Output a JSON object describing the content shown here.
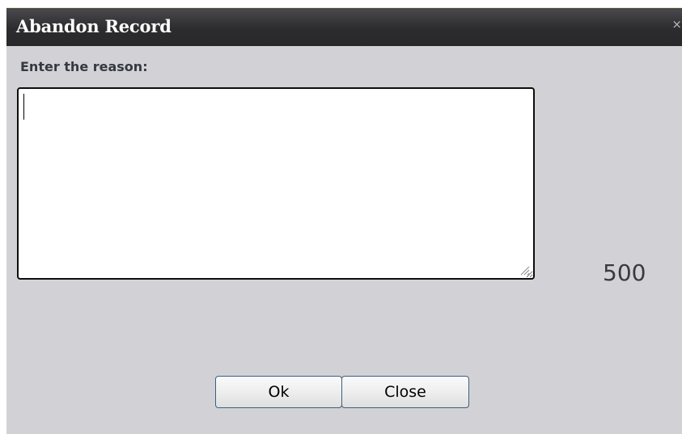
{
  "dialog": {
    "title": "Abandon Record",
    "close_glyph": "×",
    "close_icon": "close-icon"
  },
  "form": {
    "prompt_label": "Enter the reason:",
    "reason_value": "",
    "char_count": "500"
  },
  "buttons": {
    "ok_label": "Ok",
    "close_label": "Close"
  },
  "colors": {
    "title_bar": "#2c2c2f",
    "dialog_background": "#d2d2d6",
    "button_border": "#3d5e80"
  }
}
